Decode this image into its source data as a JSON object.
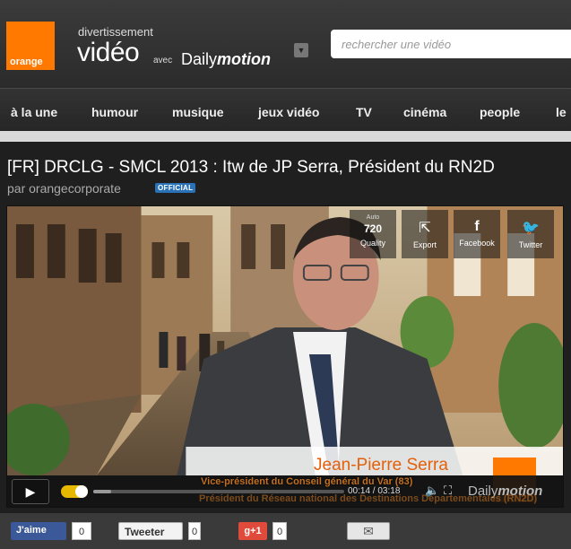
{
  "header": {
    "logo_text": "orange",
    "brand_small": "divertissement",
    "brand_video": "vidéo",
    "brand_avec": "avec",
    "brand_dm_prefix": "Daily",
    "brand_dm_bold": "motion",
    "search_placeholder": "rechercher une vidéo"
  },
  "nav": {
    "items": [
      "à la une",
      "humour",
      "musique",
      "jeux vidéo",
      "TV",
      "cinéma",
      "people",
      "le"
    ]
  },
  "video": {
    "title": "[FR] DRCLG - SMCL 2013 : Itw de JP Serra, Président du RN2D",
    "byline": "par orangecorporate",
    "official_badge": "OFFICIAL"
  },
  "player": {
    "quality_auto": "Auto",
    "quality_value": "720",
    "quality_label": "Quality",
    "export_label": "Export",
    "facebook_label": "Facebook",
    "twitter_label": "Twitter",
    "caption_name": "Jean-Pierre Serra",
    "caption_role": "Vice-président du Conseil général du Var (83)",
    "caption_org": "Président du Réseau national des Destinations Départementales (RN2D)",
    "time_current": "00:14",
    "time_total": "03:18",
    "time_separator": " / ",
    "progress_fraction": 0.07,
    "dm_logo_prefix": "Daily",
    "dm_logo_bold": "motion"
  },
  "share": {
    "fb_label": "J'aime",
    "fb_count": "0",
    "tweet_label": "Tweeter",
    "tweet_count": "0",
    "gplus_label": "g+1",
    "gplus_count": "0"
  },
  "colors": {
    "orange": "#ff7900",
    "background": "#1f1f1f"
  }
}
